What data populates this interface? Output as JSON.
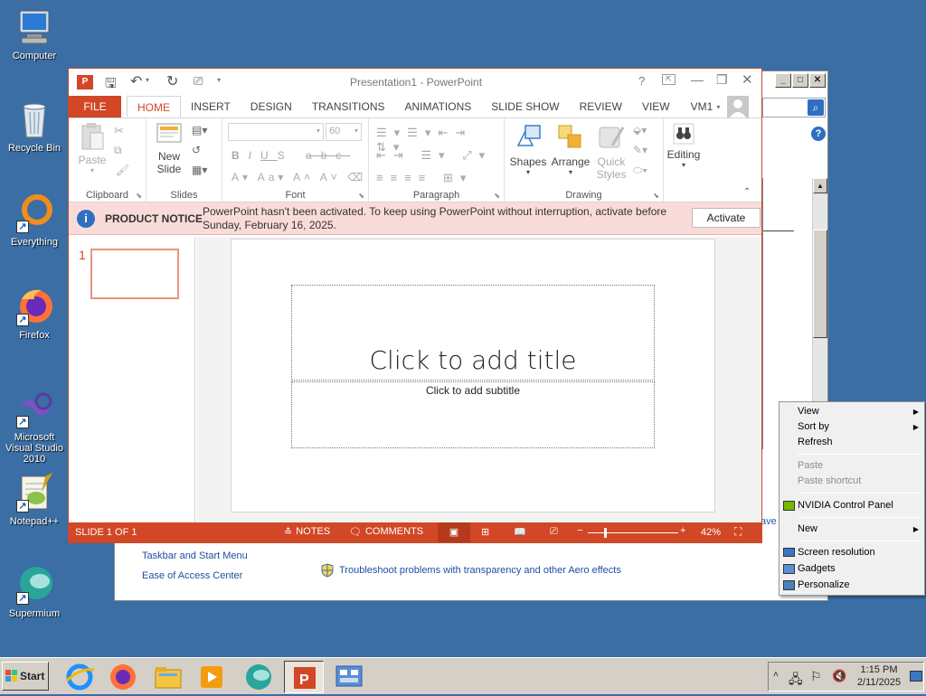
{
  "desktop": {
    "icons": [
      {
        "label": "Computer"
      },
      {
        "label": "Recycle Bin"
      },
      {
        "label": "Everything"
      },
      {
        "label": "Firefox"
      },
      {
        "label": "Microsoft Visual Studio 2010"
      },
      {
        "label": "Notepad++"
      },
      {
        "label": "Supermium"
      }
    ]
  },
  "backwin": {
    "links": [
      "Taskbar and Start Menu",
      "Ease of Access Center"
    ],
    "troubleshoot": "Troubleshoot problems with transparency and other Aero effects",
    "partial_text": "ave"
  },
  "ppt": {
    "title": "Presentation1 - PowerPoint",
    "tabs": [
      "FILE",
      "HOME",
      "INSERT",
      "DESIGN",
      "TRANSITIONS",
      "ANIMATIONS",
      "SLIDE SHOW",
      "REVIEW",
      "VIEW"
    ],
    "user": "VM1",
    "groups": {
      "clipboard": "Clipboard",
      "slides": "Slides",
      "font": "Font",
      "paragraph": "Paragraph",
      "drawing": "Drawing"
    },
    "buttons": {
      "paste": "Paste",
      "new_slide_1": "New",
      "new_slide_2": "Slide",
      "shapes": "Shapes",
      "arrange": "Arrange",
      "quick_styles_1": "Quick",
      "quick_styles_2": "Styles",
      "editing": "Editing"
    },
    "font_size": "60",
    "notice": {
      "label": "PRODUCT NOTICE",
      "text1": "PowerPoint hasn't been activated. To keep using PowerPoint without interruption, activate before",
      "text2": "Sunday, February 16, 2025.",
      "button": "Activate"
    },
    "slide_number": "1",
    "slide": {
      "title": "Click to add title",
      "subtitle": "Click to add subtitle"
    },
    "status": {
      "slide": "SLIDE 1 OF 1",
      "notes": "NOTES",
      "comments": "COMMENTS",
      "zoom": "42%"
    }
  },
  "context_menu": {
    "view": "View",
    "sort_by": "Sort by",
    "refresh": "Refresh",
    "paste": "Paste",
    "paste_shortcut": "Paste shortcut",
    "nvidia": "NVIDIA Control Panel",
    "new": "New",
    "screen_resolution": "Screen resolution",
    "gadgets": "Gadgets",
    "personalize": "Personalize"
  },
  "taskbar": {
    "start": "Start",
    "time": "1:15 PM",
    "date": "2/11/2025"
  }
}
